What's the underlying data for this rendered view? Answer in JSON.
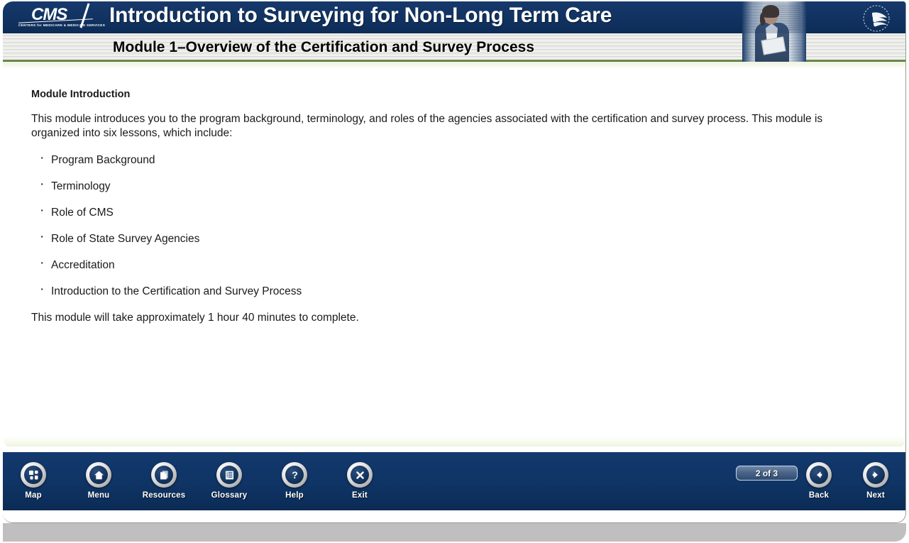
{
  "header": {
    "logo": {
      "wordmark": "CMS",
      "tagline": "CENTERS for MEDICARE & MEDICAID SERVICES"
    },
    "course_title": "Introduction to Surveying for Non-Long Term Care",
    "module_title": "Module 1–Overview of the Certification and Survey Process"
  },
  "content": {
    "section_title": "Module Introduction",
    "intro_paragraph": "This module introduces you to the program background, terminology, and roles of the agencies associated with the certification and survey process. This module is organized into six lessons, which include:",
    "lessons": [
      "Program Background",
      "Terminology",
      "Role of CMS",
      "Role of State Survey Agencies",
      "Accreditation",
      "Introduction to the Certification and Survey Process"
    ],
    "duration_note": "This module will take approximately 1 hour 40 minutes to complete."
  },
  "toolbar": {
    "nav_buttons": [
      {
        "label": "Map",
        "icon": "sitemap-icon"
      },
      {
        "label": "Menu",
        "icon": "home-icon"
      },
      {
        "label": "Resources",
        "icon": "documents-icon"
      },
      {
        "label": "Glossary",
        "icon": "book-list-icon"
      },
      {
        "label": "Help",
        "icon": "question-mark-icon"
      },
      {
        "label": "Exit",
        "icon": "close-x-icon"
      }
    ],
    "page_indicator": "2 of 3",
    "back_label": "Back",
    "next_label": "Next"
  },
  "colors": {
    "header_navy": "#123463",
    "toolbar_navy": "#0f3465",
    "accent_green": "#7f9b5c",
    "footer_gray": "#bfbfbf",
    "text_black": "#1a1a1a"
  }
}
